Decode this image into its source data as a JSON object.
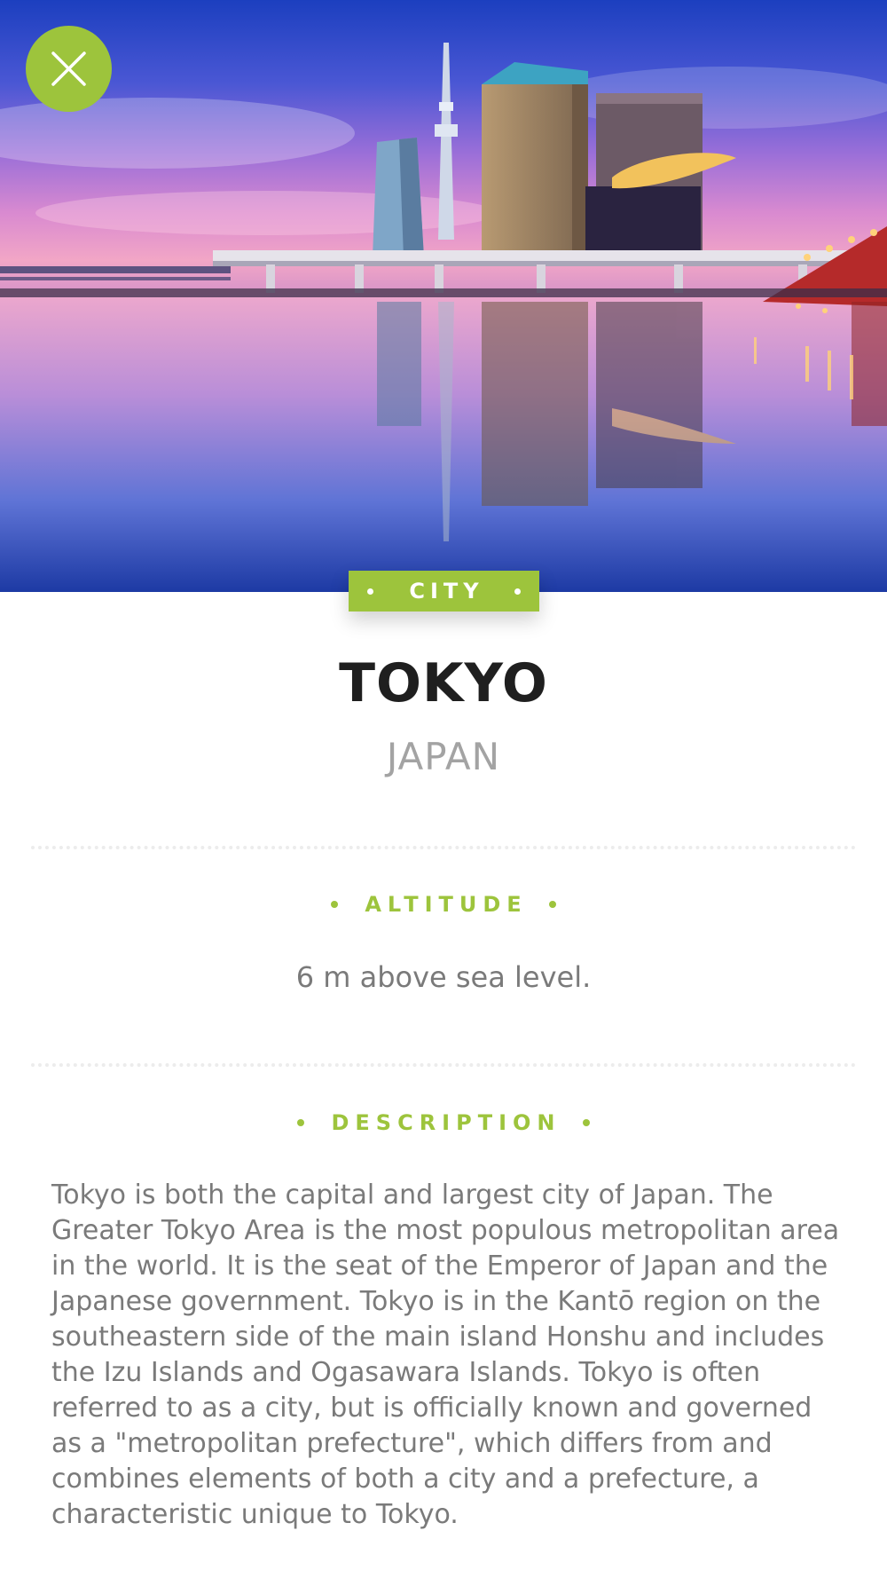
{
  "hero": {
    "image": "tokyo-skyline-river-sunset",
    "close_icon": "close-icon"
  },
  "badge": {
    "label": "CITY"
  },
  "header": {
    "title": "TOKYO",
    "subtitle": "JAPAN"
  },
  "sections": {
    "altitude": {
      "label": "ALTITUDE",
      "value": "6 m above sea level."
    },
    "description": {
      "label": "DESCRIPTION",
      "text": "Tokyo is both the capital and largest city of Japan. The Greater Tokyo Area is the most populous metropolitan area in the world. It is the seat of the Emperor of Japan and the Japanese government. Tokyo is in the Kantō region on the southeastern side of the main island Honshu and includes the Izu Islands and Ogasawara Islands. Tokyo is often referred to as a city, but is officially known and governed as a \"metropolitan prefecture\", which differs from and combines elements of both a city and a prefecture, a characteristic unique to Tokyo."
    }
  },
  "colors": {
    "accent": "#9dc43c",
    "title": "#1f1f1f",
    "subtitle": "#a3a3a3",
    "body_text": "#7a7a7a",
    "divider": "#ececec"
  }
}
